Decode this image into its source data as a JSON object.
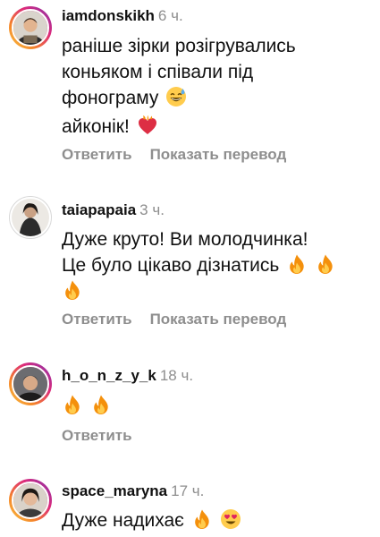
{
  "comments": [
    {
      "username": "iamdonskikh",
      "time": "6 ч.",
      "lines": [
        "раніше зірки розігрувались",
        "коньяком і співали під",
        "фонограму"
      ],
      "line2": "айконік!",
      "reply_label": "Ответить",
      "translate_label": "Показать перевод",
      "emojis": [
        "grinning-sweat-emoji",
        "heart-on-fire-emoji"
      ]
    },
    {
      "username": "taiapapaia",
      "time": "3 ч.",
      "lines": [
        "Дуже круто! Ви молодчинка!",
        "Це було цікаво дізнатись"
      ],
      "reply_label": "Ответить",
      "translate_label": "Показать перевод",
      "emojis": [
        "fire-emoji",
        "fire-emoji",
        "fire-emoji"
      ]
    },
    {
      "username": "h_o_n_z_y_k",
      "time": "18 ч.",
      "reply_label": "Ответить",
      "emojis": [
        "fire-emoji",
        "fire-emoji"
      ]
    },
    {
      "username": "space_maryna",
      "time": "17 ч.",
      "lines": [
        "Дуже надихає"
      ],
      "emojis": [
        "fire-emoji",
        "heart-eyes-emoji"
      ]
    }
  ],
  "colors": {
    "text": "#111111",
    "secondary": "#8e8e8e",
    "story_ring": "#dd2a7b",
    "fire": "#f4900c"
  }
}
